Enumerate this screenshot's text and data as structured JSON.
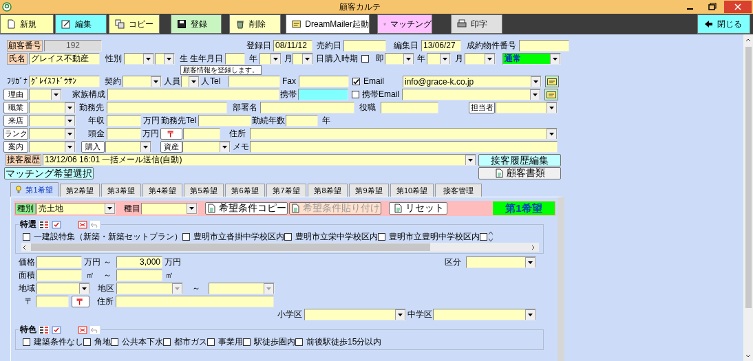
{
  "window": {
    "title": "顧客カルテ"
  },
  "toolbar": [
    {
      "label": "新規",
      "color": "#ffffb0"
    },
    {
      "label": "編集",
      "color": "#80ffff"
    },
    {
      "label": "コピー",
      "color": "#ffffb0"
    },
    {
      "label": "登録",
      "color": "#c8f5c0"
    },
    {
      "label": "削除",
      "color": "#ffffc0"
    },
    {
      "label": "DreamMailer起動",
      "color": "#ffffff"
    },
    {
      "label": "マッチング",
      "color": "#ffc0ff"
    },
    {
      "label": "印字",
      "color": "#e0e0e0"
    },
    {
      "label": "閉じる",
      "color": "#80ffff"
    }
  ],
  "tooltip": "顧客情報を登録します。",
  "customer_form": [
    [
      {
        "kind": "tag",
        "text": "顧客番号"
      },
      {
        "kind": "field",
        "value": "192",
        "disabled": true
      },
      {
        "kind": "text",
        "text": "登録日"
      },
      {
        "kind": "field",
        "value": "08/11/12"
      },
      {
        "kind": "text",
        "text": "売約日"
      },
      {
        "kind": "field"
      },
      {
        "kind": "text",
        "text": "編集日"
      },
      {
        "kind": "field",
        "value": "13/06/27"
      },
      {
        "kind": "text",
        "text": "成約物件番号"
      },
      {
        "kind": "field"
      }
    ],
    [
      {
        "kind": "tag",
        "text": "氏名"
      },
      {
        "kind": "field",
        "value": "グレイス不動産"
      },
      {
        "kind": "text",
        "text": "性別"
      },
      {
        "kind": "select"
      },
      {
        "kind": "select"
      },
      {
        "kind": "text",
        "text": "生"
      },
      {
        "kind": "text",
        "text": "生年月日"
      },
      {
        "kind": "field"
      },
      {
        "kind": "text",
        "text": "年"
      },
      {
        "kind": "select"
      },
      {
        "kind": "text",
        "text": "月"
      },
      {
        "kind": "select"
      },
      {
        "kind": "text",
        "text": "日"
      },
      {
        "kind": "text",
        "text": "購入時期"
      },
      {
        "kind": "check",
        "checked": false
      },
      {
        "kind": "text",
        "text": "即"
      },
      {
        "kind": "select"
      },
      {
        "kind": "text",
        "text": "年"
      },
      {
        "kind": "select"
      },
      {
        "kind": "text",
        "text": "月"
      },
      {
        "kind": "select"
      },
      {
        "kind": "select",
        "value": "通常",
        "color": "#00ff00"
      }
    ],
    [
      {
        "kind": "text",
        "text": "ﾌﾘｶﾞﾅ"
      },
      {
        "kind": "field",
        "value": "ｸﾞﾚｲｽﾌﾄﾞｳｻﾝ"
      },
      {
        "kind": "text",
        "text": "契約"
      },
      {
        "kind": "select"
      },
      {
        "kind": "text",
        "text": "人員"
      },
      {
        "kind": "select"
      },
      {
        "kind": "text",
        "text": "人"
      },
      {
        "kind": "text",
        "text": "Tel"
      },
      {
        "kind": "field"
      },
      {
        "kind": "text",
        "text": "Fax"
      },
      {
        "kind": "field"
      },
      {
        "kind": "check",
        "checked": true
      },
      {
        "kind": "text",
        "text": "Email"
      },
      {
        "kind": "select",
        "value": "info@grace-k.co.jp"
      },
      {
        "kind": "mail-button"
      }
    ],
    [
      {
        "kind": "btn",
        "text": "理由"
      },
      {
        "kind": "select"
      },
      {
        "kind": "text",
        "text": "家族構成"
      },
      {
        "kind": "field"
      },
      {
        "kind": "text",
        "text": "携帯"
      },
      {
        "kind": "field",
        "color": "#80ffff"
      },
      {
        "kind": "check",
        "checked": false
      },
      {
        "kind": "text",
        "text": "携帯Email"
      },
      {
        "kind": "select"
      },
      {
        "kind": "mail-button"
      }
    ],
    [
      {
        "kind": "btn",
        "text": "職業"
      },
      {
        "kind": "select"
      },
      {
        "kind": "text",
        "text": "勤務先"
      },
      {
        "kind": "field"
      },
      {
        "kind": "text",
        "text": "部署名"
      },
      {
        "kind": "field"
      },
      {
        "kind": "text",
        "text": "役職"
      },
      {
        "kind": "field"
      },
      {
        "kind": "btn",
        "text": "担当者"
      },
      {
        "kind": "select"
      }
    ],
    [
      {
        "kind": "btn",
        "text": "来店"
      },
      {
        "kind": "select"
      },
      {
        "kind": "text",
        "text": "年収"
      },
      {
        "kind": "field"
      },
      {
        "kind": "text",
        "text": "万円"
      },
      {
        "kind": "text",
        "text": "勤務先Tel"
      },
      {
        "kind": "field"
      },
      {
        "kind": "text",
        "text": "勤続年数"
      },
      {
        "kind": "field"
      },
      {
        "kind": "text",
        "text": "年"
      }
    ],
    [
      {
        "kind": "btn",
        "text": "ランク"
      },
      {
        "kind": "select"
      },
      {
        "kind": "text",
        "text": "頭金"
      },
      {
        "kind": "field"
      },
      {
        "kind": "text",
        "text": "万円"
      },
      {
        "kind": "post-button",
        "text": "〒"
      },
      {
        "kind": "field"
      },
      {
        "kind": "text",
        "text": "住所"
      },
      {
        "kind": "select"
      }
    ],
    [
      {
        "kind": "btn",
        "text": "案内"
      },
      {
        "kind": "select"
      },
      {
        "kind": "btn",
        "text": "購入"
      },
      {
        "kind": "select"
      },
      {
        "kind": "btn",
        "text": "資産"
      },
      {
        "kind": "select"
      },
      {
        "kind": "text",
        "text": "メモ"
      },
      {
        "kind": "field"
      }
    ],
    [
      {
        "kind": "tag",
        "text": "接客履歴"
      },
      {
        "kind": "select",
        "value": "13/12/06 16:01 一括メール送信(自動)"
      },
      {
        "kind": "button",
        "text": "接客履歴編集",
        "color": "#c0ffff"
      }
    ],
    [
      {
        "kind": "button",
        "text": "マッチング希望選択",
        "color": "#c0ffff"
      },
      {
        "kind": "icon-button",
        "text": "顧客書類",
        "color": "#f0f0f0"
      }
    ]
  ],
  "tabs": [
    {
      "label": "第1希望",
      "selected": true
    },
    {
      "label": "第2希望",
      "selected": false
    },
    {
      "label": "第3希望",
      "selected": false
    },
    {
      "label": "第4希望",
      "selected": false
    },
    {
      "label": "第5希望",
      "selected": false
    },
    {
      "label": "第6希望",
      "selected": false
    },
    {
      "label": "第7希望",
      "selected": false
    },
    {
      "label": "第8希望",
      "selected": false
    },
    {
      "label": "第9希望",
      "selected": false
    },
    {
      "label": "第10希望",
      "selected": false
    },
    {
      "label": "接客管理",
      "selected": false
    }
  ],
  "wish": {
    "header": [
      {
        "kind": "green-tag",
        "text": "種別"
      },
      {
        "kind": "select",
        "value": "売土地"
      },
      {
        "kind": "text",
        "text": "種目"
      },
      {
        "kind": "select"
      },
      {
        "kind": "icon-button",
        "text": "希望条件コピー",
        "color": "#ffffff"
      },
      {
        "kind": "icon-button",
        "text": "希望条件貼り付け",
        "color": "#ffe0cc",
        "disabled": true
      },
      {
        "kind": "icon-button",
        "text": "リセット",
        "color": "#ffffff"
      }
    ],
    "badge": "第1希望",
    "special": {
      "title": "特選",
      "options": [
        {
          "label": "一建設特集（新築・新築セットプラン）",
          "checked": false
        },
        {
          "label": "豊明市立沓掛中学校区内",
          "checked": false
        },
        {
          "label": "豊明市立栄中学校区内",
          "checked": false
        },
        {
          "label": "豊明市立豊明中学校区内",
          "checked": false
        },
        {
          "checked": false
        }
      ]
    },
    "rows": [
      {
        "items": [
          {
            "kind": "text",
            "text": "価格"
          },
          {
            "kind": "field"
          },
          {
            "kind": "text",
            "text": "万円"
          },
          {
            "kind": "text",
            "text": "～"
          },
          {
            "kind": "num-field",
            "value": "3,000"
          },
          {
            "kind": "text",
            "text": "万円"
          },
          {
            "kind": "text",
            "text": "区分"
          },
          {
            "kind": "select"
          }
        ]
      },
      {
        "items": [
          {
            "kind": "text",
            "text": "面積"
          },
          {
            "kind": "field"
          },
          {
            "kind": "text",
            "text": "㎡"
          },
          {
            "kind": "text",
            "text": "～"
          },
          {
            "kind": "field"
          },
          {
            "kind": "text",
            "text": "㎡"
          }
        ]
      },
      {
        "items": [
          {
            "kind": "text",
            "text": "地域"
          },
          {
            "kind": "select"
          },
          {
            "kind": "text",
            "text": "地区"
          },
          {
            "kind": "select",
            "disabled": true
          },
          {
            "kind": "text",
            "text": "～"
          },
          {
            "kind": "select",
            "disabled": true
          }
        ]
      },
      {
        "items": [
          {
            "kind": "text",
            "text": "〒"
          },
          {
            "kind": "field"
          },
          {
            "kind": "post-button",
            "text": "〒"
          },
          {
            "kind": "text",
            "text": "住所"
          },
          {
            "kind": "field"
          }
        ]
      },
      {
        "items": [
          {
            "kind": "text",
            "text": "小学区"
          },
          {
            "kind": "select"
          },
          {
            "kind": "text",
            "text": "中学区"
          },
          {
            "kind": "select"
          }
        ]
      }
    ],
    "features": {
      "title": "特色",
      "options": [
        {
          "label": "建築条件なし",
          "checked": false
        },
        {
          "label": "角地",
          "checked": false
        },
        {
          "label": "公共本下水",
          "checked": false
        },
        {
          "label": "都市ガス",
          "checked": false
        },
        {
          "label": "事業用",
          "checked": false
        },
        {
          "label": "駅徒歩圏内",
          "checked": false
        },
        {
          "label": "前後駅徒歩15分以内",
          "checked": false
        }
      ]
    }
  }
}
